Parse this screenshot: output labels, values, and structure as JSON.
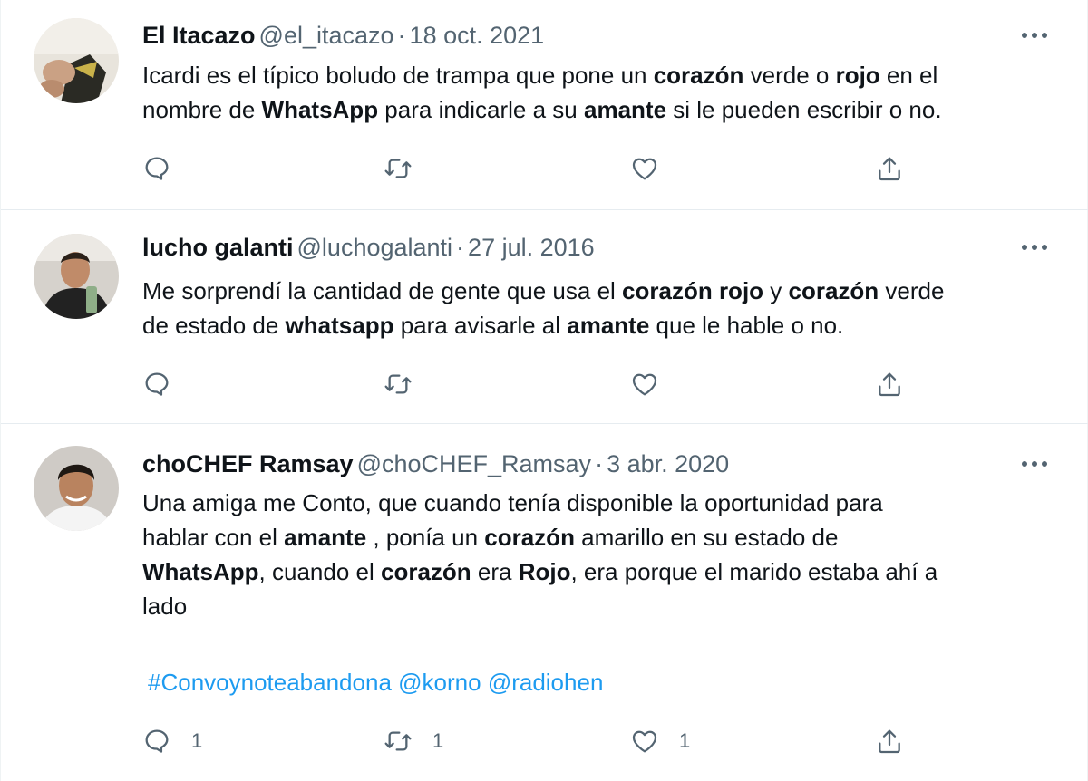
{
  "tweets": [
    {
      "name": "El Itacazo",
      "handle": "@el_itacazo",
      "separator": "·",
      "date": "18 oct. 2021",
      "lines": [
        [
          {
            "t": "Icardi es el típico boludo de trampa que pone un ",
            "b": false
          },
          {
            "t": "corazón",
            "b": true
          },
          {
            "t": " verde o ",
            "b": false
          },
          {
            "t": "rojo",
            "b": true
          },
          {
            "t": " en el",
            "b": false
          }
        ],
        [
          {
            "t": "nombre de ",
            "b": false
          },
          {
            "t": "WhatsApp",
            "b": true
          },
          {
            "t": " para indicarle a su ",
            "b": false
          },
          {
            "t": "amante",
            "b": true
          },
          {
            "t": " si le pueden escribir o no.",
            "b": false
          }
        ]
      ],
      "actions": {
        "reply": "",
        "retweet": "",
        "like": ""
      }
    },
    {
      "name": "lucho galanti",
      "handle": "@luchogalanti",
      "separator": "·",
      "date": "27 jul. 2016",
      "lines": [
        [
          {
            "t": "Me sorprendí la cantidad de gente que usa el ",
            "b": false
          },
          {
            "t": "corazón rojo",
            "b": true
          },
          {
            "t": " y ",
            "b": false
          },
          {
            "t": "corazón",
            "b": true
          },
          {
            "t": " verde",
            "b": false
          }
        ],
        [
          {
            "t": "de estado de ",
            "b": false
          },
          {
            "t": "whatsapp",
            "b": true
          },
          {
            "t": " para avisarle al ",
            "b": false
          },
          {
            "t": "amante",
            "b": true
          },
          {
            "t": " que le hable o no.",
            "b": false
          }
        ]
      ],
      "actions": {
        "reply": "",
        "retweet": "",
        "like": ""
      }
    },
    {
      "name": "choCHEF Ramsay",
      "handle": "@choCHEF_Ramsay",
      "separator": "·",
      "date": "3 abr. 2020",
      "lines": [
        [
          {
            "t": "Una amiga me Conto, que cuando tenía disponible la oportunidad para",
            "b": false
          }
        ],
        [
          {
            "t": "hablar con el ",
            "b": false
          },
          {
            "t": "amante",
            "b": true
          },
          {
            "t": " , ponía un ",
            "b": false
          },
          {
            "t": "corazón",
            "b": true
          },
          {
            "t": " amarillo en su estado de",
            "b": false
          }
        ],
        [
          {
            "t": "WhatsApp",
            "b": true
          },
          {
            "t": ", cuando el ",
            "b": false
          },
          {
            "t": "corazón",
            "b": true
          },
          {
            "t": " era ",
            "b": false
          },
          {
            "t": "Rojo",
            "b": true
          },
          {
            "t": ", era porque el marido estaba ahí a",
            "b": false
          }
        ],
        [
          {
            "t": "lado",
            "b": false
          }
        ]
      ],
      "hashtags": [
        "#Convoynoteabandona",
        "@korno",
        "@radiohen"
      ],
      "actions": {
        "reply": "1",
        "retweet": "1",
        "like": "1"
      }
    }
  ],
  "colors": {
    "text": "#0f1419",
    "muted": "#536471",
    "link": "#1d9bf0",
    "divider": "#e6ecf0"
  },
  "icons": [
    "reply-icon",
    "retweet-icon",
    "like-icon",
    "share-icon",
    "more-options-icon"
  ]
}
